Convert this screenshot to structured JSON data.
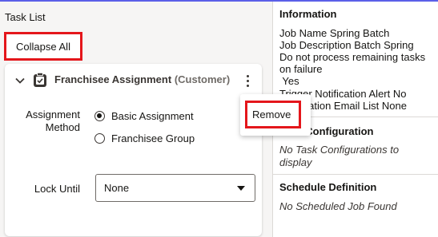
{
  "task_list": {
    "title": "Task List",
    "collapse_all_label": "Collapse All",
    "card": {
      "title": "Franchisee Assignment",
      "subtitle": "(Customer)",
      "assignment_method_label": "Assignment Method",
      "radio_options": [
        {
          "label": "Basic Assignment",
          "checked": true
        },
        {
          "label": "Franchisee Group",
          "checked": false
        }
      ],
      "lock_until_label": "Lock Until",
      "lock_until_value": "None"
    },
    "menu": {
      "remove_label": "Remove"
    }
  },
  "information": {
    "title": "Information",
    "lines": [
      "Job Name Spring Batch",
      "Job Description Batch Spring",
      "Do not process remaining tasks",
      "on failure",
      " Yes",
      "Trigger Notification Alert No",
      "Notification Email List None"
    ]
  },
  "task_configuration": {
    "title": "Task Configuration",
    "empty_text_line1": "No Task Configurations to",
    "empty_text_line2": "display"
  },
  "schedule_definition": {
    "title": "Schedule Definition",
    "empty_text": "No Scheduled Job Found"
  },
  "colors": {
    "accent_line": "#5b5fe8",
    "highlight_red": "#e4161b",
    "panel_bg": "#f6f5f4"
  }
}
